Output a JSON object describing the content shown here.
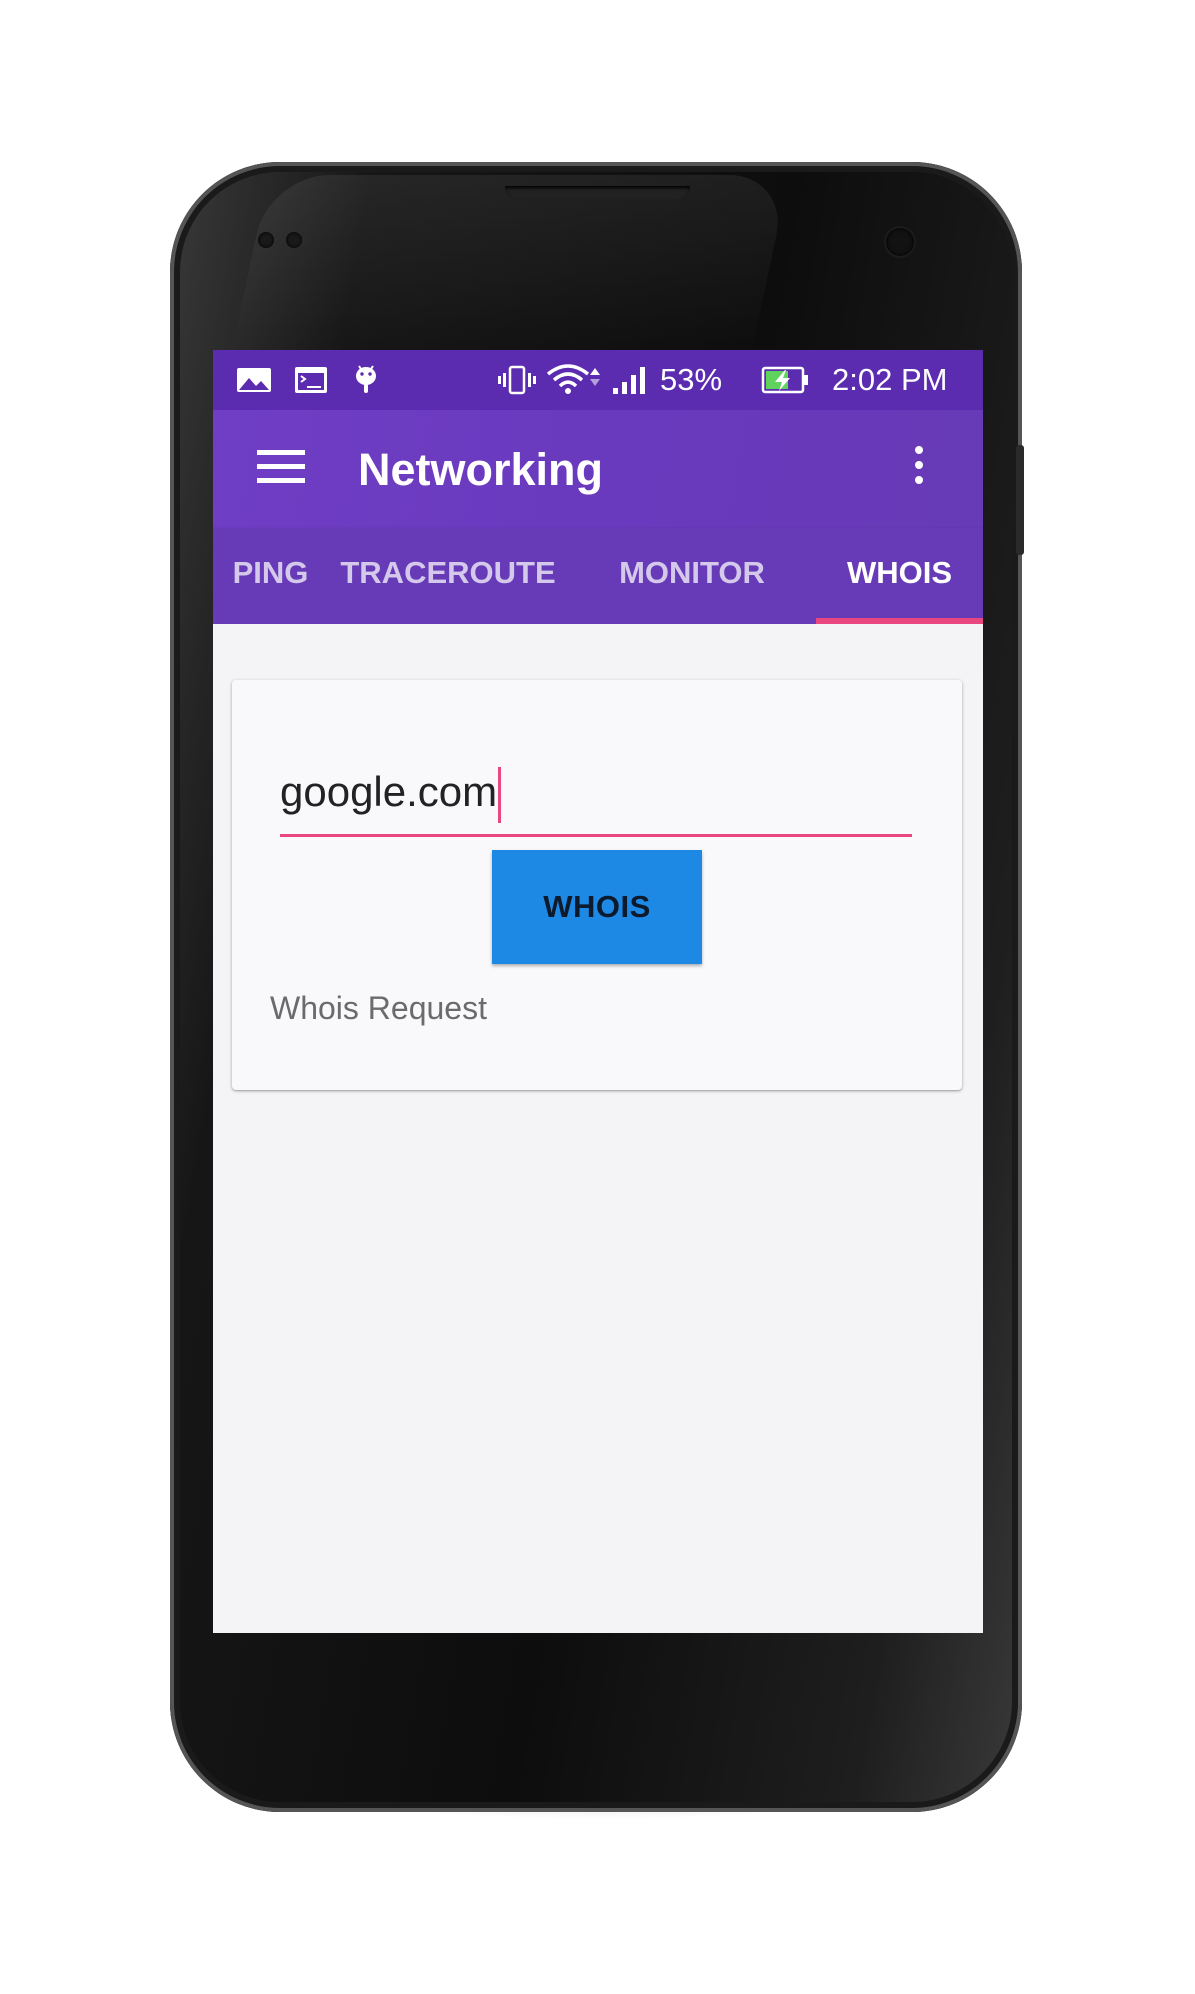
{
  "status_bar": {
    "battery_percent": "53%",
    "time": "2:02 PM",
    "left_icons": [
      "image-icon",
      "terminal-icon",
      "android-icon"
    ],
    "right_icons": [
      "vibrate-icon",
      "wifi-icon",
      "signal-icon",
      "battery-charging-icon"
    ]
  },
  "toolbar": {
    "title": "Networking",
    "menu_icon": "hamburger-menu-icon",
    "overflow_icon": "more-vert-icon"
  },
  "tabs": [
    {
      "label": "PING",
      "active": false
    },
    {
      "label": "TRACEROUTE",
      "active": false
    },
    {
      "label": "MONITOR",
      "active": false
    },
    {
      "label": "WHOIS",
      "active": true
    }
  ],
  "whois_card": {
    "input_value": "google.com",
    "button_label": "WHOIS",
    "result_label": "Whois Request"
  },
  "colors": {
    "primary": "#673ab7",
    "status_bar": "#5b2bb0",
    "accent": "#e8487f",
    "button": "#1e88e5"
  }
}
